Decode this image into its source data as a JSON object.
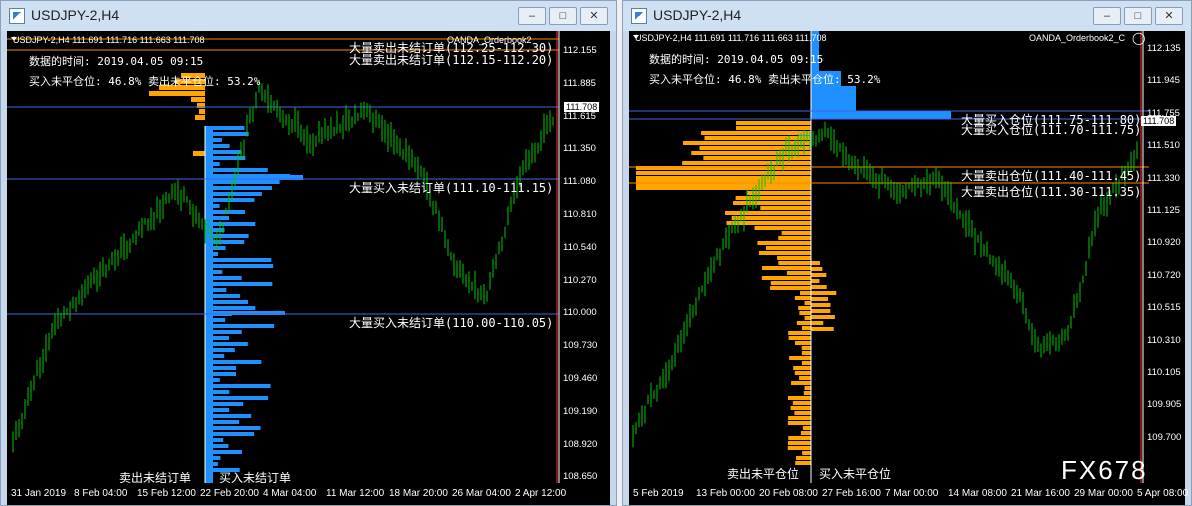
{
  "left": {
    "title": "USDJPY-2,H4",
    "header_text": "USDJPY-2,H4  111.691 111.716 111.663 111.708",
    "time_label": "数据的时间: 2019.04.05 09:15",
    "ratio_label": "买入未平仓位: 46.8%  卖出未平仓位: 53.2%",
    "corner_label": "OANDA_Orderbook2",
    "annotations": [
      "大量卖出未结订单(112.25-112.30)",
      "大量卖出未结订单(112.15-112.20)",
      "大量买入未结订单(111.10-111.15)",
      "大量买入未结订单(110.00-110.05)"
    ],
    "bottom_left": "卖出未结订单",
    "bottom_right": "买入未结订单",
    "price_tag": "111.708",
    "yticks": [
      "112.155",
      "111.885",
      "111.615",
      "111.350",
      "111.080",
      "110.810",
      "110.540",
      "110.270",
      "110.000",
      "109.730",
      "109.460",
      "109.190",
      "108.920",
      "108.650"
    ],
    "xticks": [
      "31 Jan 2019",
      "8 Feb 04:00",
      "15 Feb 12:00",
      "22 Feb 20:00",
      "4 Mar 04:00",
      "11 Mar 12:00",
      "18 Mar 20:00",
      "26 Mar 04:00",
      "2 Apr 12:00"
    ]
  },
  "right": {
    "title": "USDJPY-2,H4",
    "header_text": "USDJPY-2,H4  111.691 111.716 111.663 111.708",
    "time_label": "数据的时间: 2019.04.05 09:15",
    "ratio_label": "买入未平仓位: 46.8%  卖出未平仓位: 53.2%",
    "corner_label": "OANDA_Orderbook2_C",
    "annotations": [
      "大量买入仓位(111.75-111.80)",
      "大量买入仓位(111.70-111.75)",
      "大量卖出仓位(111.40-111.45)",
      "大量卖出仓位(111.30-111.35)"
    ],
    "bottom_left": "卖出未平仓位",
    "bottom_right": "买入未平仓位",
    "price_tag": "111.708",
    "yticks": [
      "112.135",
      "111.945",
      "111.755",
      "111.510",
      "111.330",
      "111.125",
      "110.920",
      "110.720",
      "110.515",
      "110.310",
      "110.105",
      "109.905",
      "109.700"
    ],
    "xticks": [
      "5 Feb 2019",
      "13 Feb 00:00",
      "20 Feb 08:00",
      "27 Feb 16:00",
      "7 Mar 00:00",
      "14 Mar 08:00",
      "21 Mar 16:00",
      "29 Mar 00:00",
      "5 Apr 08:00"
    ],
    "watermark": "FX678"
  },
  "colors": {
    "bg": "#000000",
    "candle": "#00c800",
    "buy_bars": "#1e90ff",
    "sell_bars": "#ffa500",
    "level_line_blue": "#4169e1",
    "level_line_orange": "#ff8c00",
    "current_price_line": "#ff3030"
  }
}
